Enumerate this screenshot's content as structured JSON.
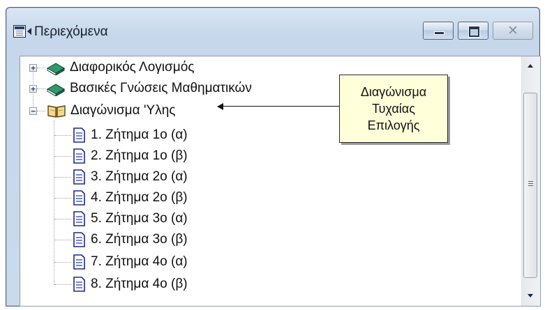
{
  "window": {
    "title": "Περιεχόμενα",
    "app_icon": "window-app-icon",
    "system_menu_icon": "system-menu-arrow-icon",
    "buttons": {
      "minimize": "minimize-icon",
      "maximize": "maximize-icon",
      "close": {
        "glyph": "✕",
        "icon": "close-icon"
      }
    }
  },
  "tree": {
    "items": [
      {
        "label": "Διαφορικός Λογισμός",
        "icon": "closed-book-icon",
        "expander": "+",
        "expanded": false
      },
      {
        "label": "Βασικές Γνώσεις Μαθηματικών",
        "icon": "closed-book-icon",
        "expander": "+",
        "expanded": false
      },
      {
        "label": "Διαγώνισμα 'Υλης",
        "icon": "open-book-icon",
        "expander": "−",
        "expanded": true,
        "children": [
          {
            "label": "1. Ζήτημα 1ο (α)",
            "icon": "document-icon"
          },
          {
            "label": "2. Ζήτημα 1ο (β)",
            "icon": "document-icon"
          },
          {
            "label": "3. Ζήτημα 2ο (α)",
            "icon": "document-icon"
          },
          {
            "label": "4. Ζήτημα 2ο (β)",
            "icon": "document-icon"
          },
          {
            "label": "5. Ζήτημα 3ο (α)",
            "icon": "document-icon"
          },
          {
            "label": "6. Ζήτημα 3ο (β)",
            "icon": "document-icon"
          },
          {
            "label": "7. Ζήτημα 4ο (α)",
            "icon": "document-icon"
          },
          {
            "label": "8. Ζήτημα 4ο (β)",
            "icon": "document-icon"
          }
        ]
      }
    ]
  },
  "callout": {
    "text": "Διαγώνισμα\nΤυχαίας\nΕπιλογής",
    "arrow_icon": "left-arrow-icon"
  },
  "scrollbar": {
    "up_icon": "scroll-up-arrow-icon",
    "down_icon": "scroll-down-arrow-icon",
    "grip_icon": "scroll-grip-icon"
  },
  "colors": {
    "title_bar": "#c9daed",
    "book_green": "#1f7a5a",
    "open_book": "#f4d98a",
    "document_blue": "#3c50c8",
    "callout_bg": "#ffffd9"
  }
}
